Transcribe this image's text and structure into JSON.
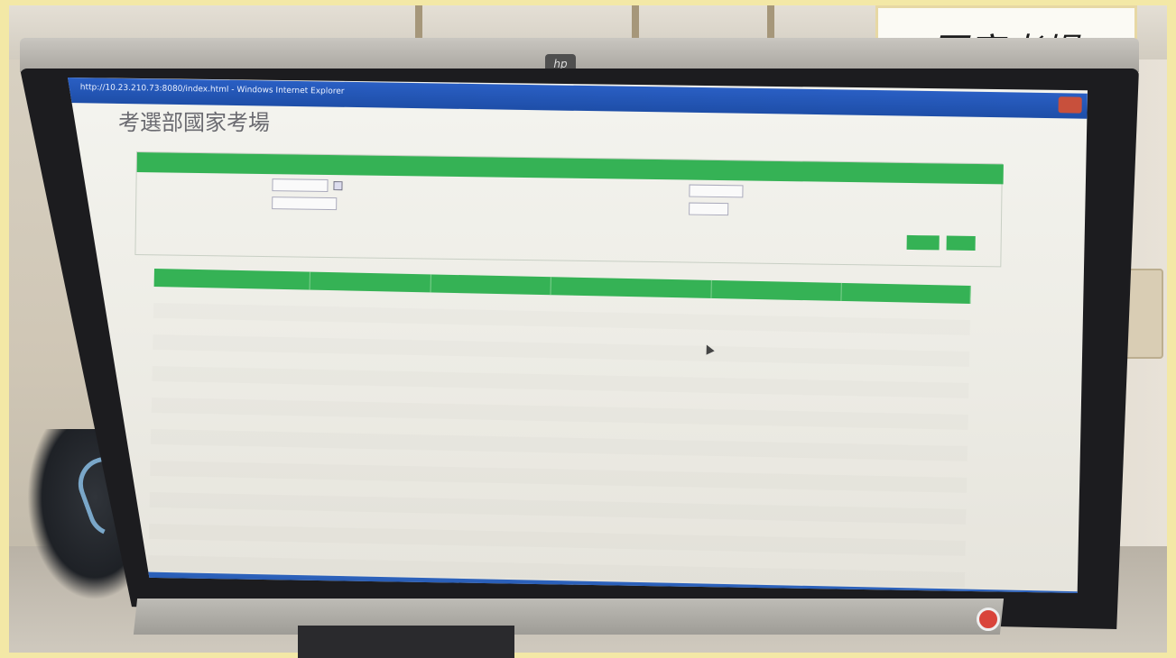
{
  "sign": {
    "text": "國家考場"
  },
  "monitor": {
    "brand_logo": "hp",
    "power_indicator_color": "#d9443a"
  },
  "screen": {
    "window_title": "http://10.23.210.73:8080/index.html - Windows Internet Explorer",
    "page_title": "考選部國家考場",
    "breadcrumb": "",
    "query_panel": {
      "header": "",
      "date_label": "",
      "date_value": "",
      "dropdown1_label": "",
      "dropdown1_value": "",
      "dropdown2_label": "",
      "dropdown2_value": "",
      "dropdown3_label": "",
      "dropdown3_value": "",
      "query_button": "",
      "clear_button": ""
    },
    "table": {
      "caption": "",
      "columns": [
        "",
        "",
        "",
        "",
        "",
        ""
      ],
      "column_widths_rel": [
        1.75,
        1.35,
        1.35,
        1.8,
        1.45,
        1.45
      ],
      "row_count": 18
    },
    "accent_color": "#35b255",
    "titlebar_color": "#2a5fc4"
  }
}
